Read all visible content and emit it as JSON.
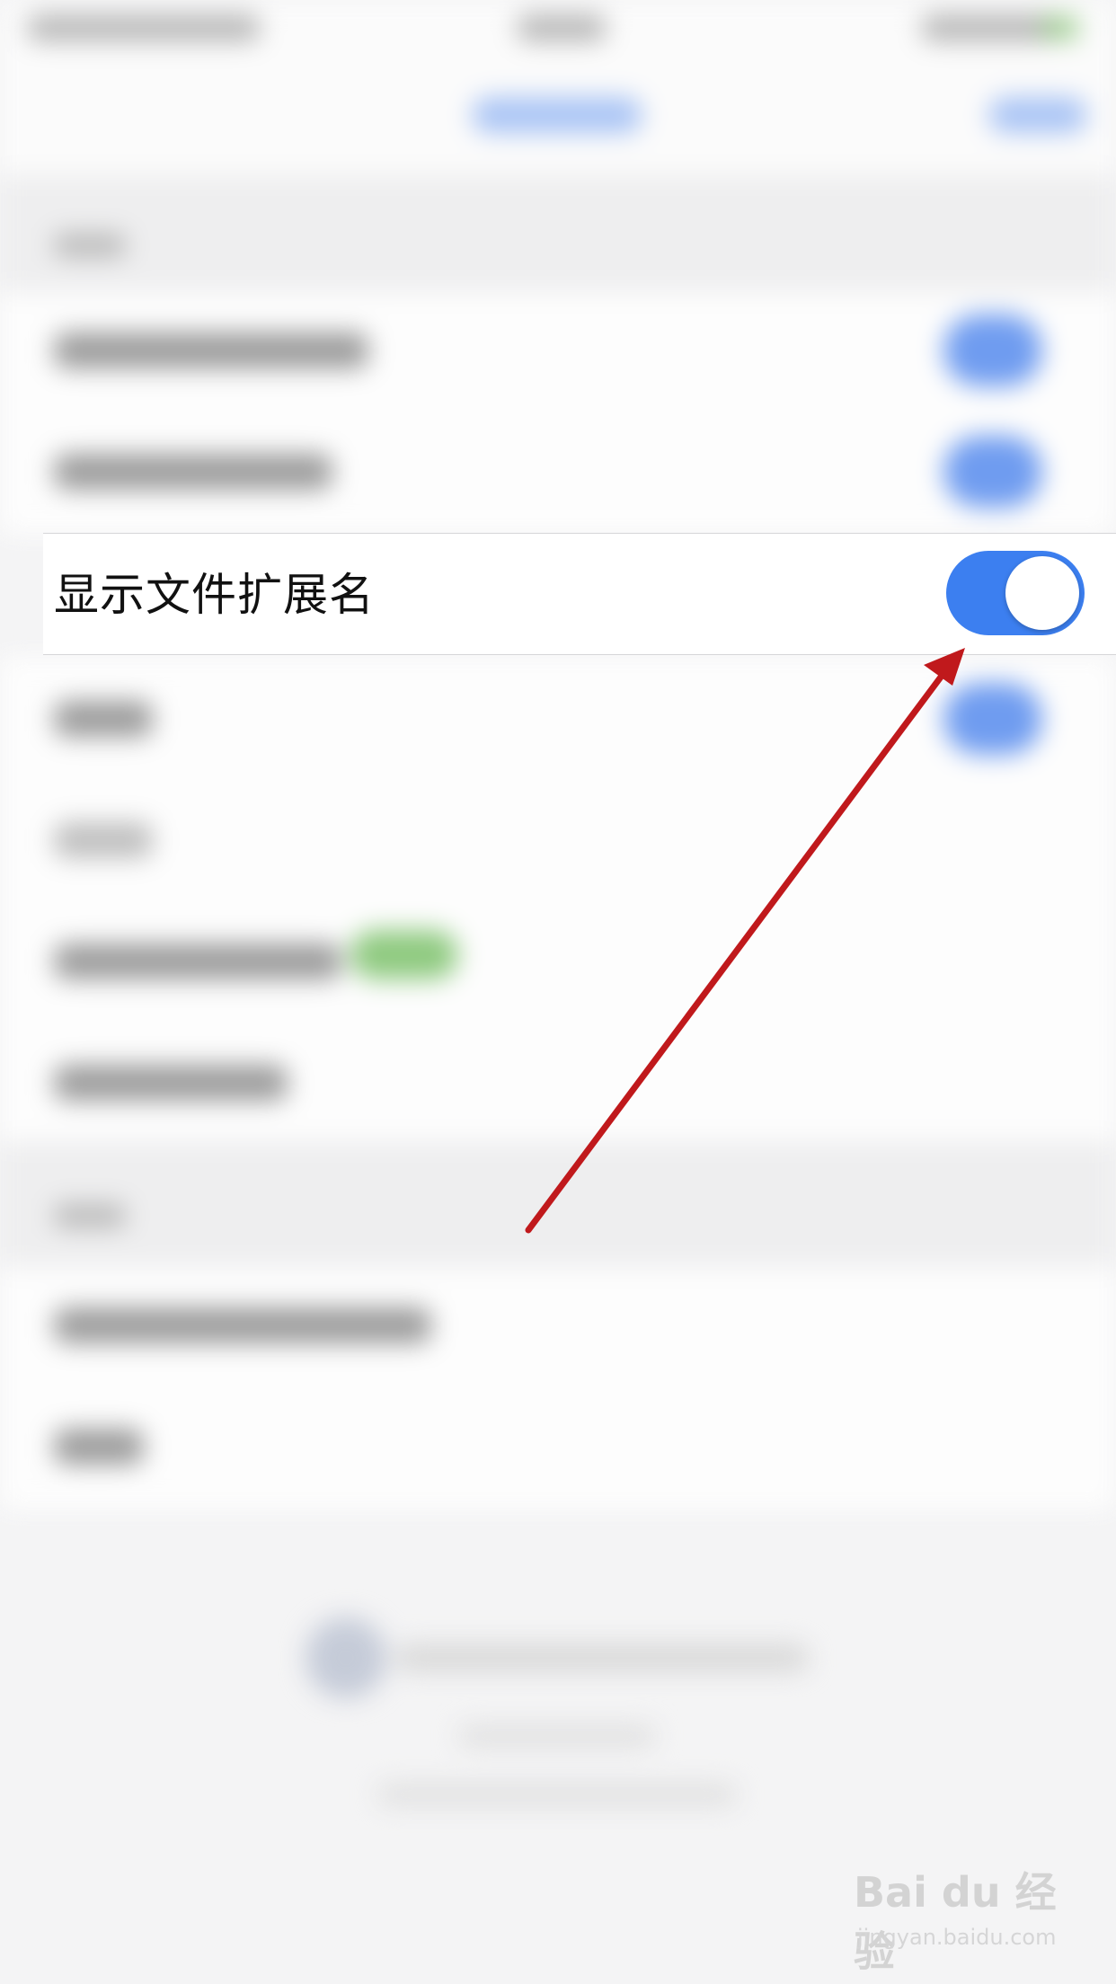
{
  "settings_row": {
    "label": "显示文件扩展名",
    "toggle_on": true
  },
  "colors": {
    "toggle_on": "#3c7ff0",
    "arrow": "#c0191c",
    "background": "#f4f4f5"
  },
  "watermark": {
    "logo": "Bai du 经验",
    "url": "jingyan.baidu.com"
  }
}
